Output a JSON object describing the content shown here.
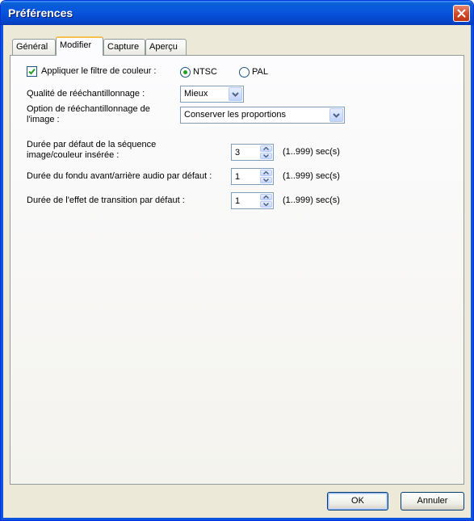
{
  "window": {
    "title": "Préférences"
  },
  "tabs": [
    {
      "label": "Général"
    },
    {
      "label": "Modifier"
    },
    {
      "label": "Capture"
    },
    {
      "label": "Aperçu"
    }
  ],
  "modifier": {
    "color_filter": {
      "label": "Appliquer le filtre de couleur :",
      "checked": true
    },
    "radios": [
      {
        "label": "NTSC",
        "selected": true
      },
      {
        "label": "PAL",
        "selected": false
      }
    ],
    "resample_quality": {
      "label": "Qualité de rééchantillonnage :",
      "value": "Mieux"
    },
    "resample_option": {
      "label_line1": "Option de rééchantillonnage de",
      "label_line2": "l'image :",
      "value": "Conserver les proportions"
    },
    "durations": [
      {
        "label_line1": "Durée par défaut de la séquence",
        "label_line2": "image/couleur insérée :",
        "value": "3",
        "range": "(1..999) sec(s)"
      },
      {
        "label_line1": "Durée du fondu avant/arrière audio par défaut :",
        "label_line2": "",
        "value": "1",
        "range": "(1..999) sec(s)"
      },
      {
        "label_line1": "Durée de l'effet de transition par défaut :",
        "label_line2": "",
        "value": "1",
        "range": "(1..999) sec(s)"
      }
    ]
  },
  "buttons": {
    "ok": "OK",
    "cancel": "Annuler"
  },
  "colors": {
    "title_bar": "#0855dd",
    "dialog_bg": "#ece9d8",
    "close_button": "#d24d2c",
    "active_tab_accent": "#f6c04e",
    "radio_dot": "#21a121"
  },
  "icons": {
    "close": "close-icon",
    "check": "check-icon",
    "dropdown": "chevron-down-icon",
    "spin_up": "spin-up-icon",
    "spin_down": "spin-down-icon"
  }
}
